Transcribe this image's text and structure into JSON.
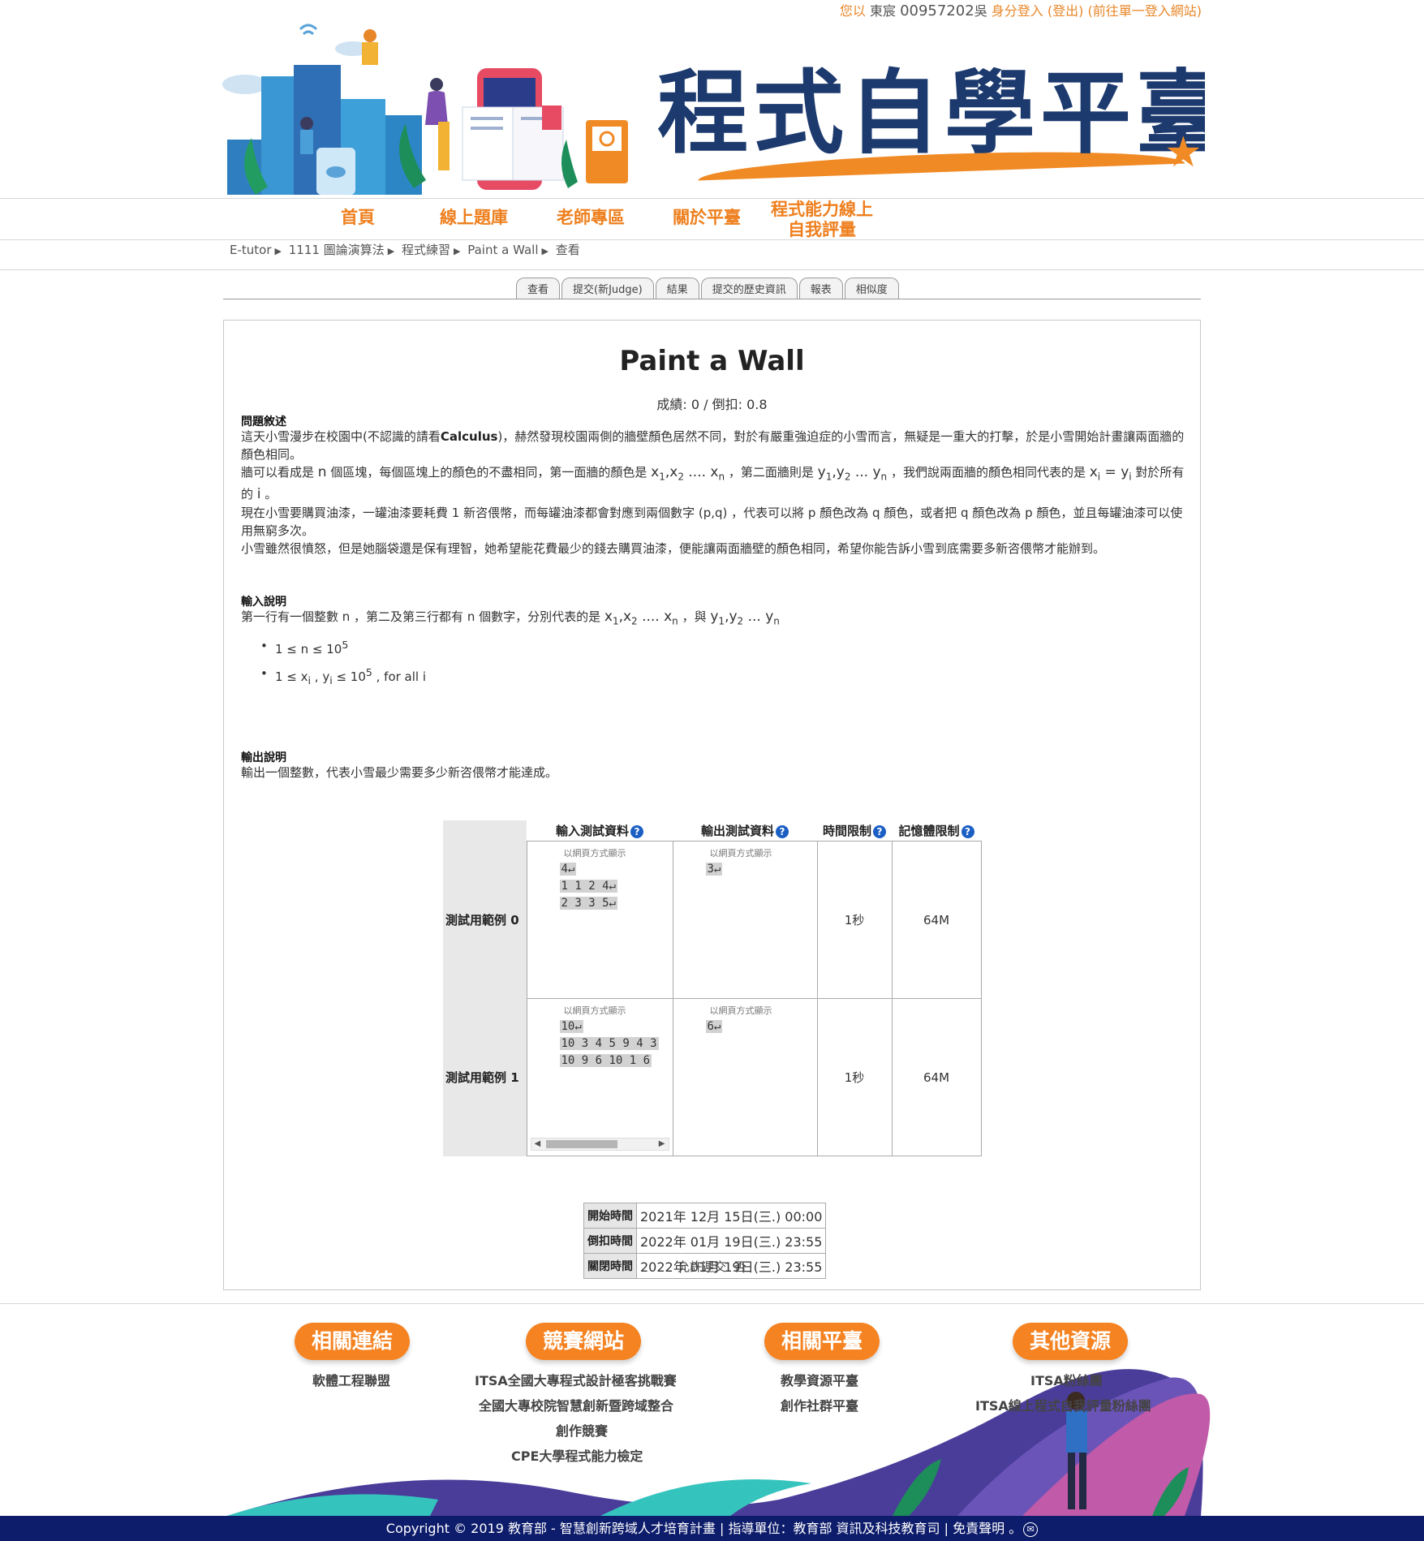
{
  "topbar": {
    "greeting": "您以",
    "user_name": "東宸",
    "user_id": "00957202",
    "user_suffix": "吳",
    "login_method": "身分登入",
    "logout": "(登出)",
    "sso_link": "(前往單一登入網站)"
  },
  "banner": {
    "title": "程式自學平臺"
  },
  "nav": {
    "items": [
      "首頁",
      "線上題庫",
      "老師專區",
      "關於平臺"
    ],
    "assessment_line1": "程式能力線上",
    "assessment_line2": "自我評量"
  },
  "breadcrumb": [
    "E-tutor",
    "1111 圖論演算法",
    "程式練習",
    "Paint a Wall",
    "查看"
  ],
  "tabs": [
    "查看",
    "提交(新Judge)",
    "結果",
    "提交的歷史資訊",
    "報表",
    "相似度"
  ],
  "problem": {
    "title": "Paint a Wall",
    "score_line": "成績: 0 / 倒扣: 0.8",
    "desc_heading": "問題敘述",
    "desc_p1_a": "這天小雪漫步在校園中(不認識的請看",
    "desc_p1_bold": "Calculus",
    "desc_p1_b": ")，赫然發現校園兩側的牆壁顏色居然不同，對於有嚴重強迫症的小雪而言，無疑是一重大的打擊，於是小雪開始計畫讓兩面牆的顏色相同。",
    "desc_p2_a": "牆可以看成是",
    "desc_p2_b": "個區塊，每個區塊上的顏色的不盡相同，第一面牆的顏色是",
    "desc_p2_c": "，第二面牆則是",
    "desc_p2_d": "，我們說兩面牆的顏色相同代表的是",
    "desc_p2_e": "對於所有的",
    "desc_p2_f": "。",
    "desc_p3": "現在小雪要購買油漆，一罐油漆要耗費 1 新咨偎幣，而每罐油漆都會對應到兩個數字 (p,q) ，代表可以將 p 顏色改為 q 顏色，或者把 q 顏色改為 p 顏色，並且每罐油漆可以使用無窮多次。",
    "desc_p4": "小雪雖然很憤怒，但是她腦袋還是保有理智，她希望能花費最少的錢去購買油漆，便能讓兩面牆壁的顏色相同，希望你能告訴小雪到底需要多新咨偎幣才能辦到。",
    "input_heading": "輸入說明",
    "input_a": "第一行有一個整數 n ，第二及第三行都有 n 個數字，分別代表的是",
    "input_b": "，與",
    "bullet1": "1 ≤ n ≤ 10",
    "bullet2_tail": ", for all i",
    "output_heading": "輸出說明",
    "output_text": "輸出一個整數，代表小雪最少需要多少新咨偎幣才能達成。"
  },
  "samples": {
    "headers": [
      "輸入測試資料",
      "輸出測試資料",
      "時間限制",
      "記憶體限制"
    ],
    "web_view": "以網頁方式顯示",
    "rows": [
      {
        "label": "測試用範例 0",
        "input": [
          "4↵",
          "1 1 2 4↵",
          "2 3 3 5↵"
        ],
        "output": [
          "3↵"
        ],
        "time": "1秒",
        "memory": "64M"
      },
      {
        "label": "測試用範例 1",
        "input": [
          "10↵",
          "10 3 4 5 9 4 3",
          "10 9 6 10 1 6"
        ],
        "output": [
          "6↵"
        ],
        "time": "1秒",
        "memory": "64M"
      }
    ]
  },
  "times": [
    {
      "label": "開始時間",
      "value": "2021年 12月 15日(三.) 00:00"
    },
    {
      "label": "倒扣時間",
      "value": "2022年 01月 19日(三.) 23:55"
    },
    {
      "label": "關閉時間",
      "value": "2022年 01月 19日(三.) 23:55"
    }
  ],
  "allow_late": "允許遲交: 否",
  "footer": {
    "groups": [
      {
        "title": "相關連結",
        "links": [
          "軟體工程聯盟"
        ]
      },
      {
        "title": "競賽網站",
        "links": [
          "ITSA全國大專程式設計極客挑戰賽",
          "全國大專校院智慧創新暨跨域整合",
          "創作競賽",
          "CPE大學程式能力檢定"
        ]
      },
      {
        "title": "相關平臺",
        "links": [
          "教學資源平臺",
          "創作社群平臺"
        ]
      },
      {
        "title": "其他資源",
        "links": [
          "ITSA粉絲團",
          "ITSA線上程式自我評量粉絲團"
        ]
      }
    ],
    "copyright": "Copyright © 2019 教育部 - 智慧創新跨域人才培育計畫 | 指導單位：教育部 資訊及科技教育司 | 免責聲明 。"
  },
  "colors": {
    "accent": "#ee7f1e",
    "navy": "#1c3a6e",
    "footer_bar": "#0d1c6b"
  }
}
